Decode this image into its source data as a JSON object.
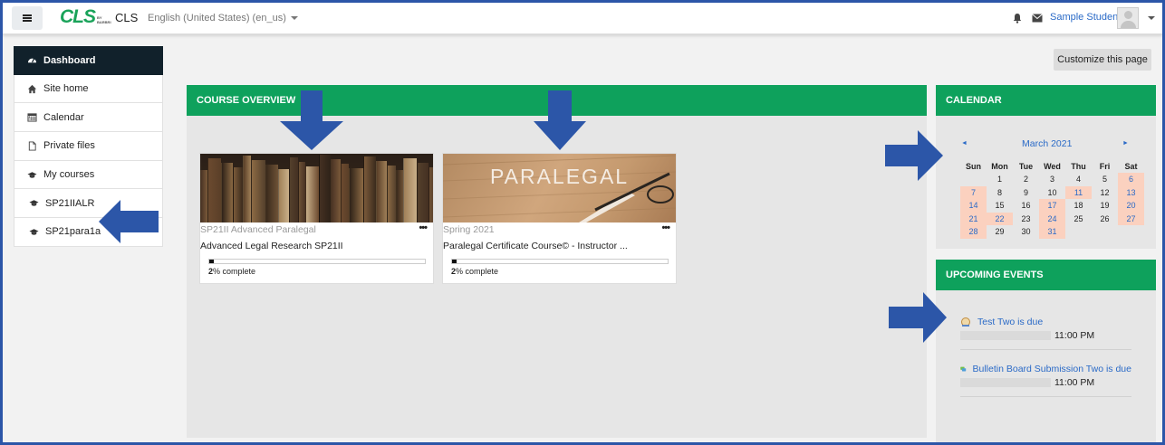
{
  "navbar": {
    "logo_text": "CLS",
    "logo_sub": "BY BARBRI",
    "site_name": "CLS",
    "language": "English (United States) (en_us)",
    "user_name": "Sample Student"
  },
  "nav": {
    "items": [
      {
        "label": "Dashboard",
        "icon": "dashboard-icon",
        "active": true
      },
      {
        "label": "Site home",
        "icon": "home-icon"
      },
      {
        "label": "Calendar",
        "icon": "calendar-icon"
      },
      {
        "label": "Private files",
        "icon": "file-icon"
      },
      {
        "label": "My courses",
        "icon": "graduation-cap-icon"
      },
      {
        "label": "SP21IIALR",
        "icon": "graduation-cap-icon"
      },
      {
        "label": "SP21para1a",
        "icon": "graduation-cap-icon"
      }
    ]
  },
  "main": {
    "customize_label": "Customize this page"
  },
  "course_overview": {
    "title": "COURSE OVERVIEW",
    "courses": [
      {
        "category": "SP21II Advanced Paralegal",
        "name": "Advanced Legal Research SP21II",
        "progress": 2,
        "progress_label": "% complete",
        "image": "books"
      },
      {
        "category": "Spring 2021",
        "name": "Paralegal Certificate Course© - Instructor ...",
        "progress": 2,
        "progress_label": "% complete",
        "image": "paralegal",
        "image_text": "PARALEGAL"
      }
    ],
    "menu_dots": "•••"
  },
  "calendar": {
    "title": "CALENDAR",
    "month": "March 2021",
    "prev": "◄",
    "next": "►",
    "weekdays": [
      "Sun",
      "Mon",
      "Tue",
      "Wed",
      "Thu",
      "Fri",
      "Sat"
    ],
    "weeks": [
      [
        "",
        "1",
        "2",
        "3",
        "4",
        "5",
        "6"
      ],
      [
        "7",
        "8",
        "9",
        "10",
        "11",
        "12",
        "13"
      ],
      [
        "14",
        "15",
        "16",
        "17",
        "18",
        "19",
        "20"
      ],
      [
        "21",
        "22",
        "23",
        "24",
        "25",
        "26",
        "27"
      ],
      [
        "28",
        "29",
        "30",
        "31",
        "",
        "",
        ""
      ]
    ],
    "event_days": [
      "11",
      "17",
      "22",
      "24",
      "31"
    ]
  },
  "upcoming_events": {
    "title": "UPCOMING EVENTS",
    "events": [
      {
        "title": "Test Two is due",
        "time": "11:00 PM",
        "icon": "quiz-icon"
      },
      {
        "title": "Bulletin Board Submission Two is due",
        "time": "11:00 PM",
        "icon": "forum-icon"
      }
    ]
  },
  "colors": {
    "accent_green": "#0ea15c",
    "link_blue": "#2a6ac7",
    "nav_active": "#11212b",
    "arrow_blue": "#2c56a8",
    "calendar_highlight": "#fbd1bf"
  }
}
